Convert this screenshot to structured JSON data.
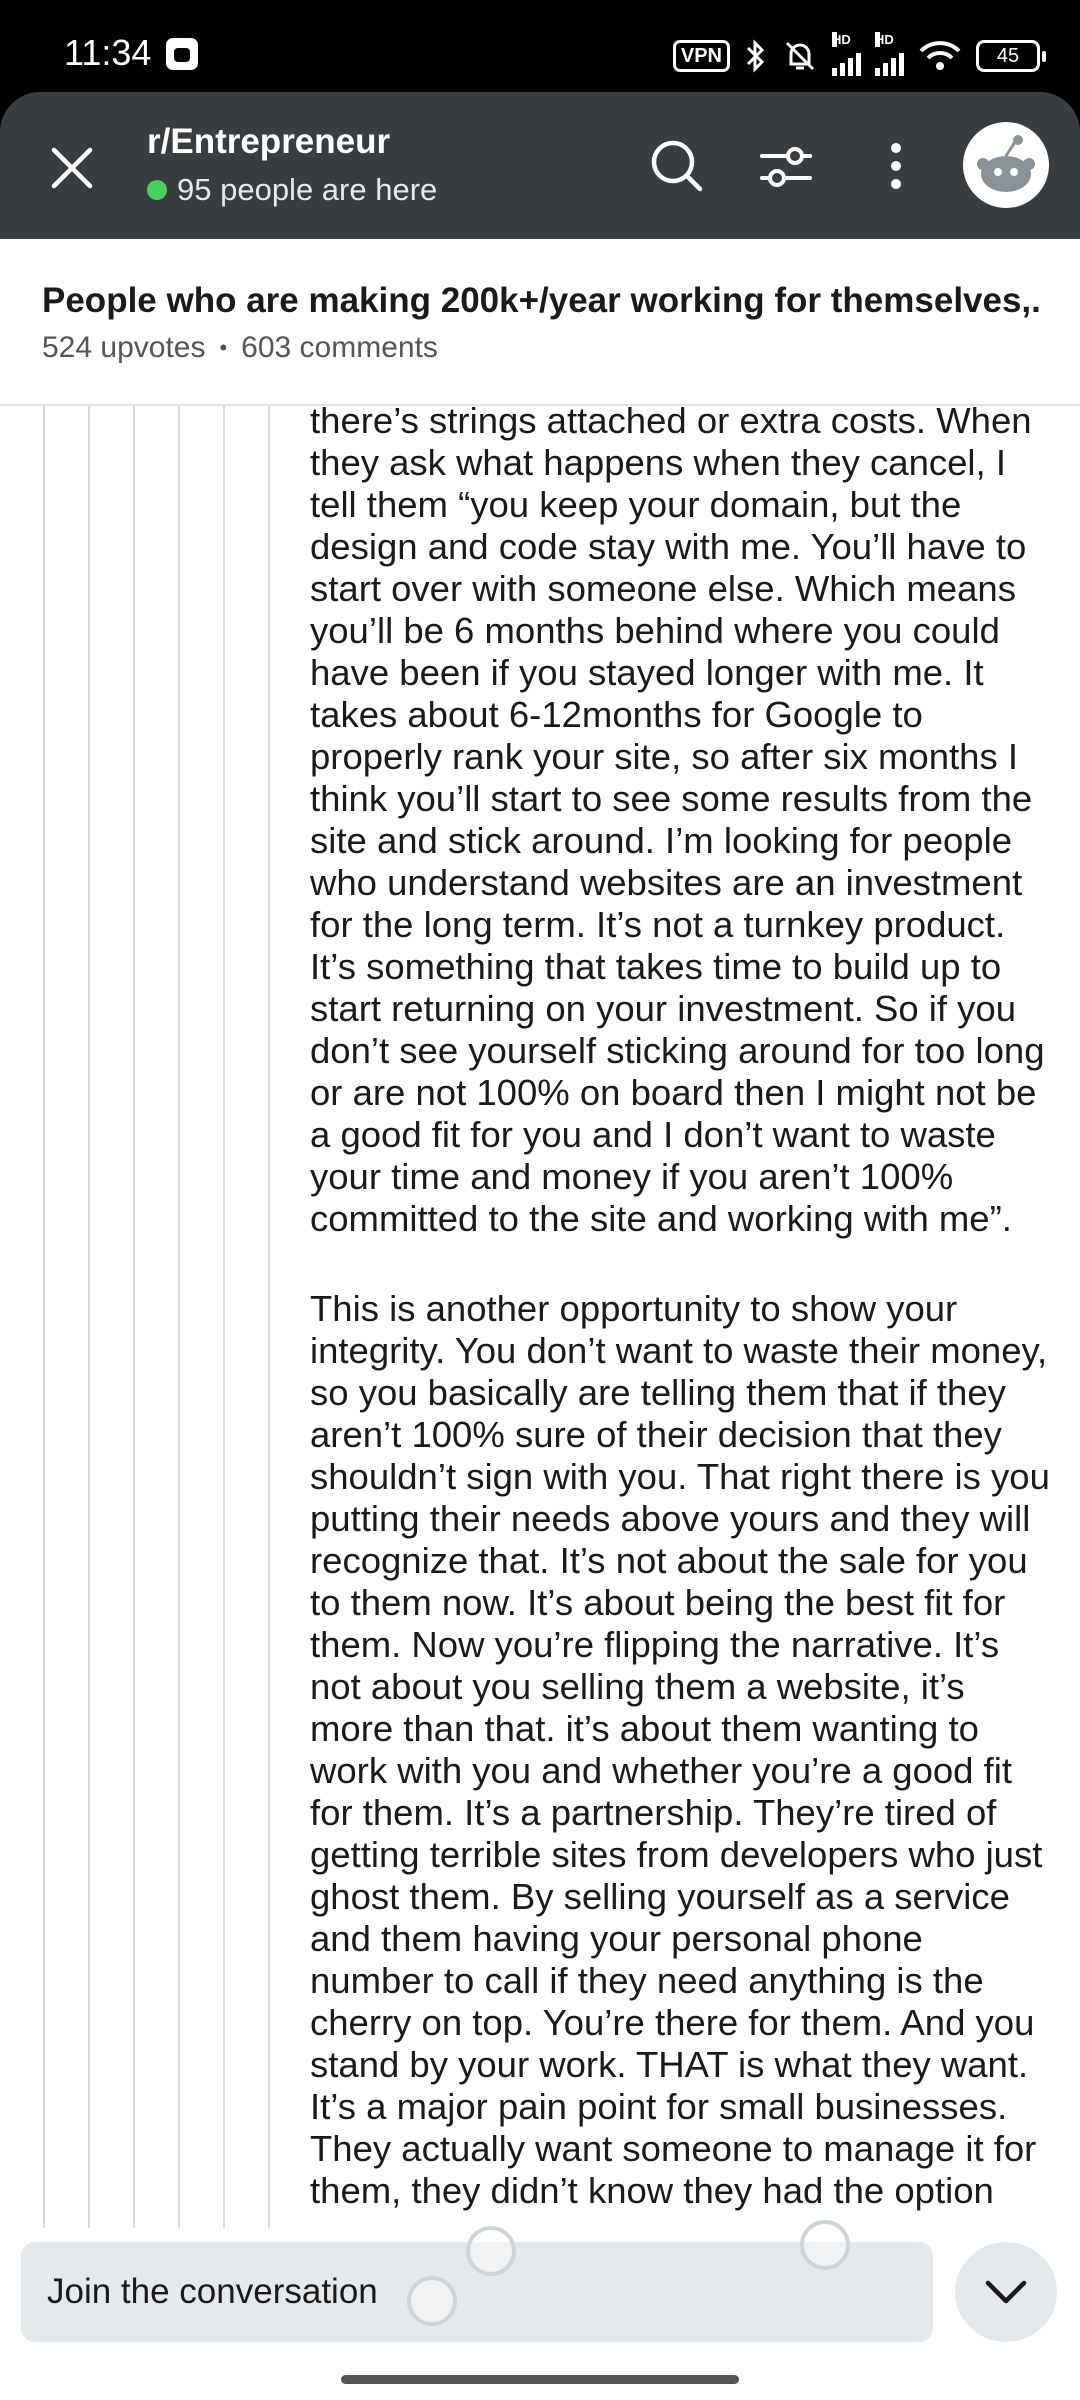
{
  "status_bar": {
    "time": "11:34",
    "vpn": "VPN",
    "hd1": "HD",
    "hd2": "HD",
    "battery": "45"
  },
  "header": {
    "subreddit": "r/Entrepreneur",
    "online_text": "95 people are here"
  },
  "post": {
    "title": "People who are making 200k+/year working for themselves,...",
    "upvotes": "524 upvotes",
    "separator": "•",
    "comments": "603 comments"
  },
  "comment": {
    "paragraphs": [
      "there’s strings attached or extra costs. When they ask what happens when they cancel, I tell them “you keep your domain, but the design and code stay with me. You’ll have to start over with someone else. Which means you’ll be 6 months behind where you could have been if you stayed longer with me. It takes about 6-12months for Google to properly rank your site, so after six months I think you’ll start to see some results from the site and stick around. I’m looking for people who understand websites are an investment for the long term. It’s not a turnkey product. It’s something that takes time to build up to start returning on your investment. So if you don’t see yourself sticking around for too long or are not 100% on board then I might not be a good fit for you and I don’t want to waste your time and money if you aren’t 100% committed to the site and working with me”.",
      "This is another opportunity to show your integrity. You don’t want to waste their money, so you basically are telling them that if they aren’t 100% sure of their decision that they shouldn’t sign with you. That right there is you putting their needs above yours and they will recognize that. It’s not about the sale for you to them now. It’s about being the best fit for them. Now you’re flipping the narrative. It’s not about you selling them a website, it’s more than that. it’s about them wanting to work with you and whether you’re a good fit for them. It’s a partnership. They’re tired of getting terrible sites from developers who just ghost them. By selling yourself as a service and them having your personal phone number to call if they need anything is the cherry on top. You’re there for them. And you stand by your work. THAT is what they want. It’s a major pain point for small businesses. They actually want someone to manage it for them, they didn’t know they had the option"
    ]
  },
  "bottom": {
    "join_placeholder": "Join the conversation"
  },
  "colors": {
    "header_bg": "#3a3d40",
    "online_dot": "#46d160",
    "input_bg": "#e6e9ec"
  },
  "icons": [
    "close-icon",
    "search-icon",
    "filter-icon",
    "more-vertical-icon",
    "avatar-icon",
    "chevron-down-icon"
  ]
}
